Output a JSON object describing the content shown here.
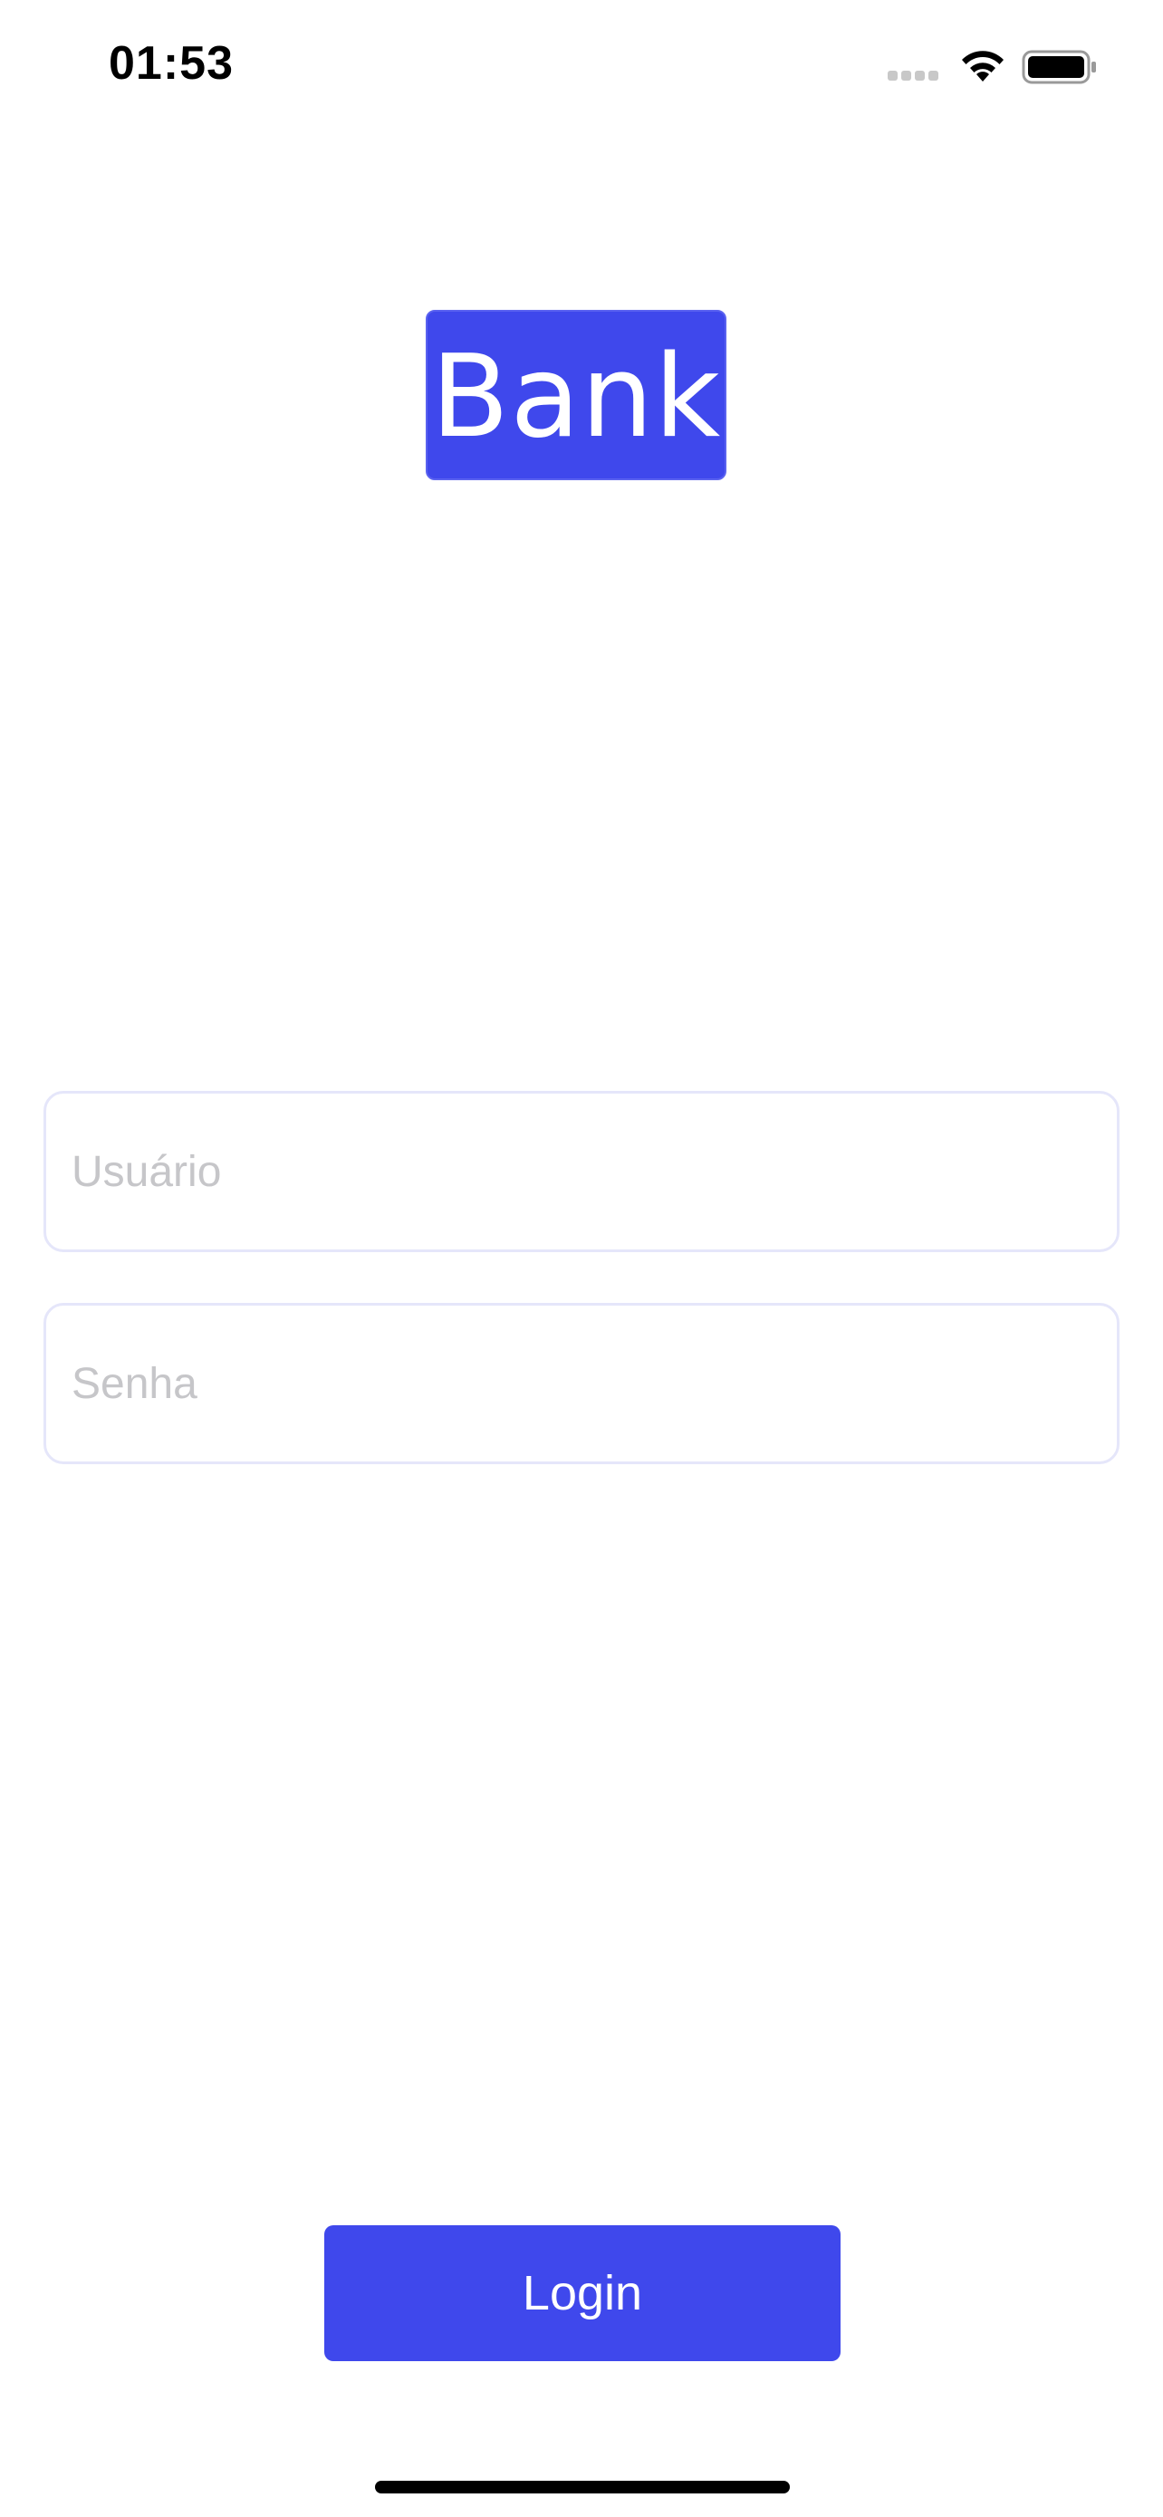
{
  "status_bar": {
    "time": "01:53",
    "icons": [
      "signal-icon",
      "wifi-icon",
      "battery-icon"
    ]
  },
  "logo": {
    "text": "Bank",
    "color": "#3f48ec"
  },
  "form": {
    "username_placeholder": "Usuário",
    "username_value": "",
    "password_placeholder": "Senha",
    "password_value": ""
  },
  "login_button": {
    "label": "Login",
    "color": "#3f48ec"
  }
}
